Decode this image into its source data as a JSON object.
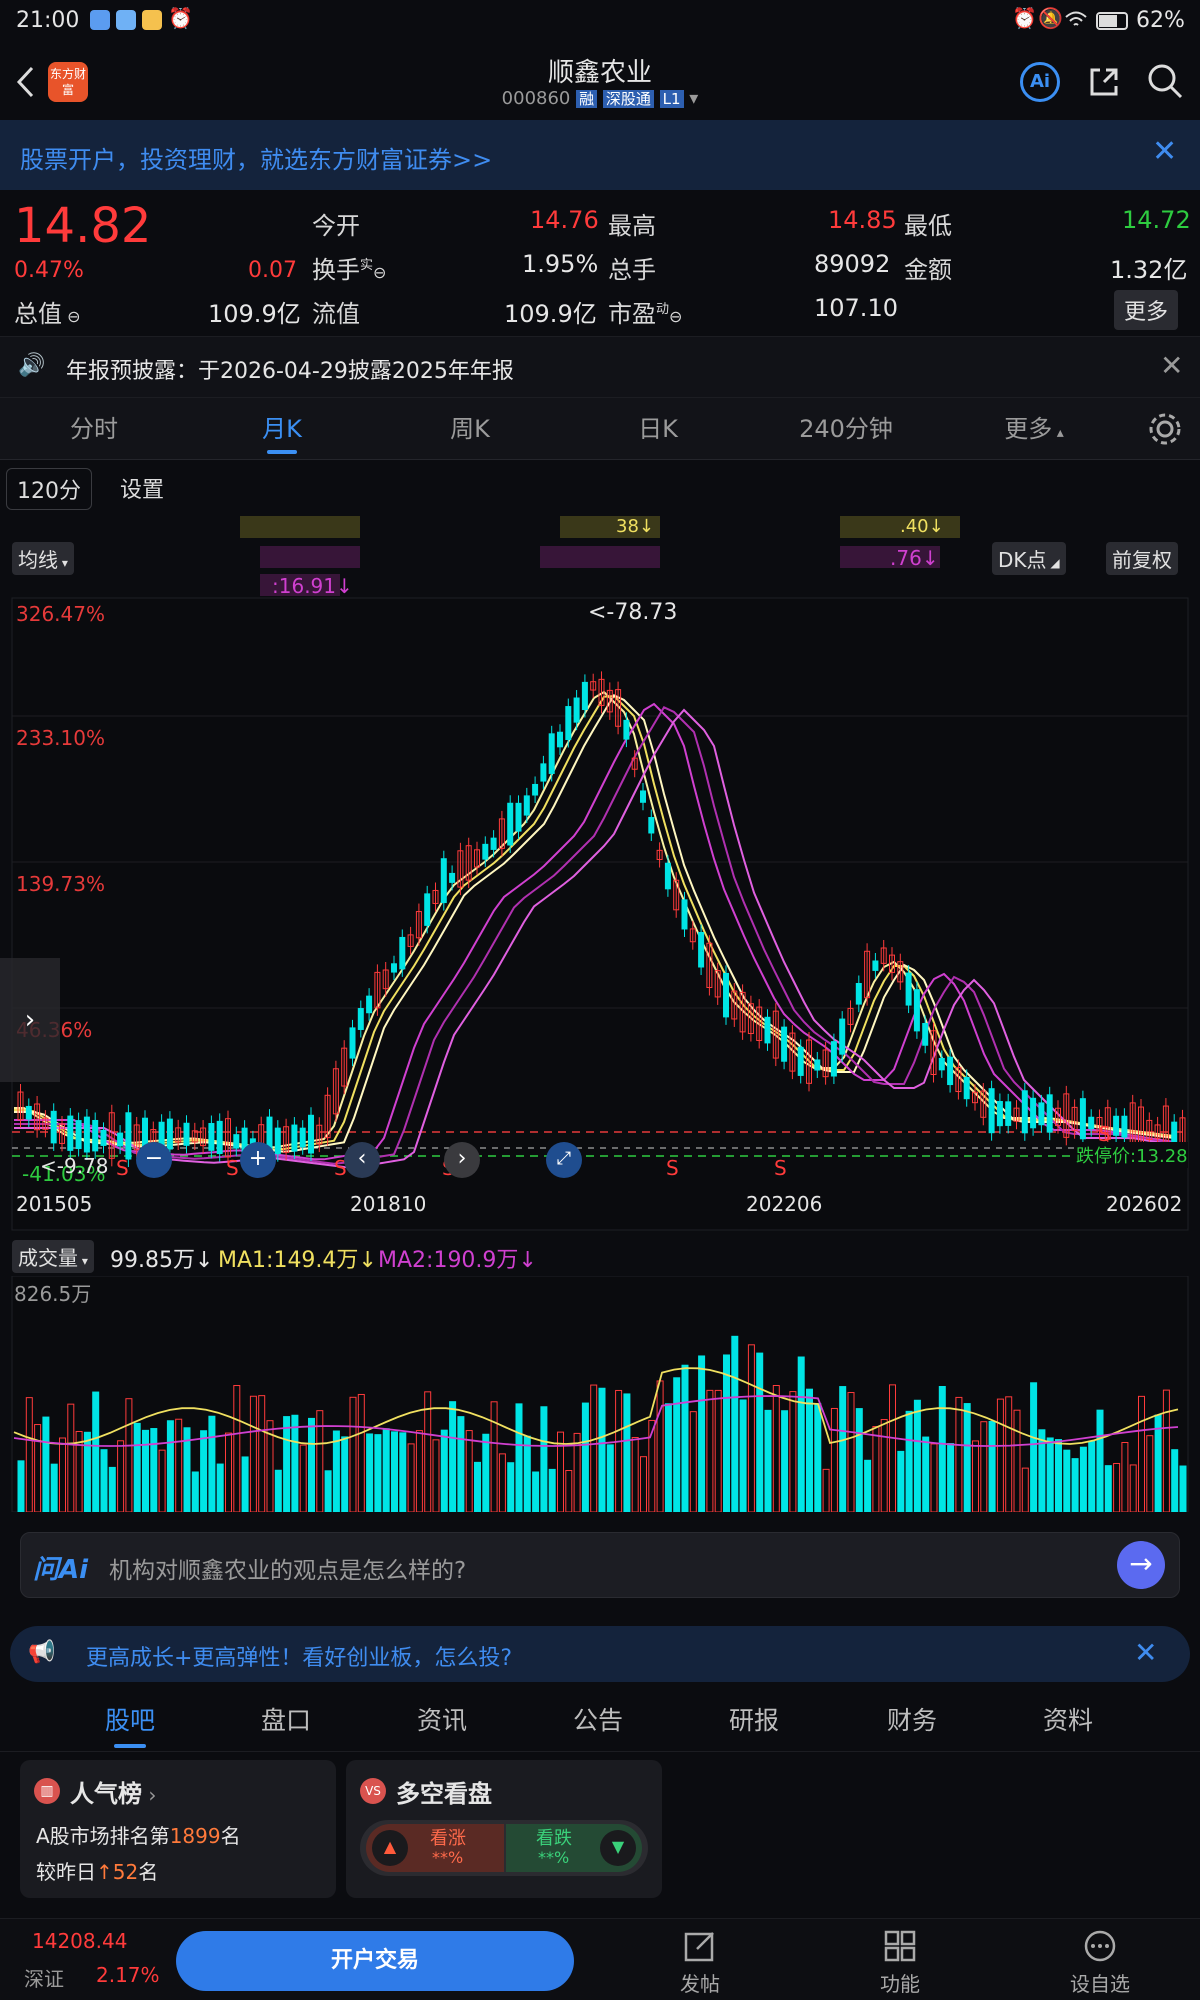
{
  "status_bar": {
    "time": "21:00",
    "battery": "62%"
  },
  "header": {
    "title": "顺鑫农业",
    "code": "000860",
    "tags": [
      "融",
      "深股通",
      "L1"
    ],
    "logo_text": "东方财富"
  },
  "promo": {
    "text": "股票开户，投资理财，就选东方财富证券>>"
  },
  "quote": {
    "price": "14.82",
    "change_pct": "0.47%",
    "change": "0.07",
    "fields": {
      "open_label": "今开",
      "open": "14.76",
      "high_label": "最高",
      "high": "14.85",
      "low_label": "最低",
      "low": "14.72",
      "turnover_label": "换手",
      "turnover_sup": "实",
      "turnover": "1.95%",
      "volume_label": "总手",
      "volume": "89092",
      "amount_label": "金额",
      "amount": "1.32亿",
      "mcap_label": "总值",
      "mcap": "109.9亿",
      "float_label": "流值",
      "float": "109.9亿",
      "pe_label": "市盈",
      "pe_sup": "动",
      "pe": "107.10"
    },
    "more_button": "更多"
  },
  "notice": {
    "text": "年报预披露：于2026-04-29披露2025年年报"
  },
  "kline_tabs": [
    "分时",
    "月K",
    "周K",
    "日K",
    "240分钟",
    "更多"
  ],
  "kline_active": 1,
  "chart_toolbar": {
    "period": "120分",
    "settings": "设置",
    "ma_label": "均线",
    "dk_label": "DK点",
    "adjust_label": "前复权"
  },
  "ma_legend": {
    "ma_top1": "38",
    "ma_top2": ".40",
    "ma_mid": ".76",
    "ma_left": "16.91"
  },
  "chart_data": {
    "type": "candlestick",
    "y_axis_labels": [
      "326.47%",
      "233.10%",
      "139.73%",
      "46.36%",
      "-41.03%"
    ],
    "x_axis_labels": [
      "201505",
      "201810",
      "202206",
      "202602"
    ],
    "max_label": "<-78.73",
    "min_label": "<-9.78",
    "limit_down_label": "跌停价:13.28",
    "signals": [
      "S",
      "S",
      "S",
      "S",
      "S",
      "S",
      "S",
      "S"
    ]
  },
  "volume_chart": {
    "title": "成交量",
    "value": "99.85万",
    "ma1": "MA1:149.4万",
    "ma2": "MA2:190.9万",
    "max_label": "826.5万"
  },
  "ai_box": {
    "logo": "问Ai",
    "placeholder": "机构对顺鑫农业的观点是怎么样的?"
  },
  "ad2": {
    "text": "更高成长+更高弹性！看好创业板，怎么投?"
  },
  "bottom_tabs": [
    "股吧",
    "盘口",
    "资讯",
    "公告",
    "研报",
    "财务",
    "资料"
  ],
  "bottom_active": 0,
  "popularity": {
    "title": "人气榜",
    "line1_prefix": "A股市场排名第",
    "rank": "1899",
    "line1_suffix": "名",
    "line2_prefix": "较昨日",
    "delta": "52",
    "line2_suffix": "名"
  },
  "bullbear": {
    "title": "多空看盘",
    "up_label": "看涨",
    "up_val": "**%",
    "down_label": "看跌",
    "down_val": "**%"
  },
  "bottom_bar": {
    "index_value": "14208.44",
    "index_name": "深证",
    "index_change": "2.17%",
    "trade_button": "开户交易",
    "post": "发帖",
    "function": "功能",
    "watchlist": "设自选"
  },
  "colors": {
    "up": "#ff3b3b",
    "down": "#00e5e5",
    "accent": "#3b8ff3",
    "background": "#0b0c10"
  }
}
